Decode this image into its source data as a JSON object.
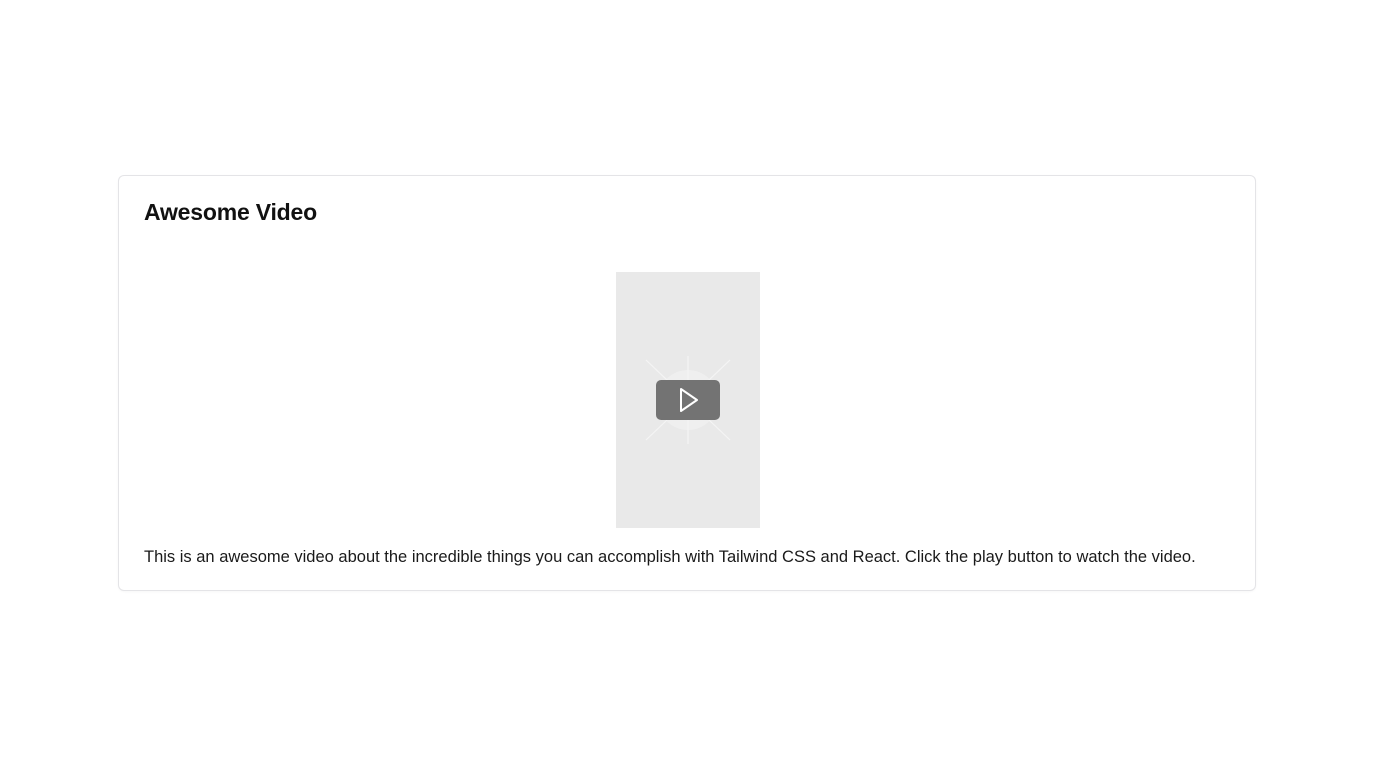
{
  "card": {
    "title": "Awesome Video",
    "description": "This is an awesome video about the incredible things you can accomplish with Tailwind CSS and React. Click the play button to watch the video."
  },
  "video": {
    "play_icon": "play-icon",
    "placeholder_color": "#e9e9e9",
    "button_color": "#737373"
  }
}
